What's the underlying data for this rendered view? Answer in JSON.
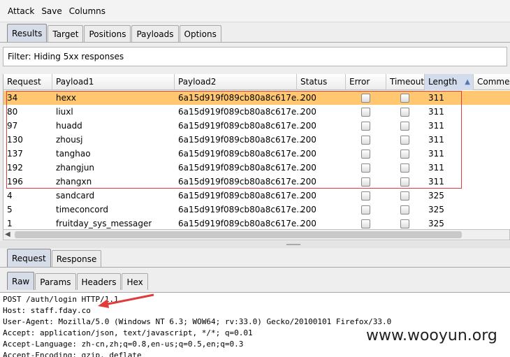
{
  "menu": [
    "Attack",
    "Save",
    "Columns"
  ],
  "main_tabs": [
    {
      "label": "Results",
      "active": true
    },
    {
      "label": "Target",
      "active": false
    },
    {
      "label": "Positions",
      "active": false
    },
    {
      "label": "Payloads",
      "active": false
    },
    {
      "label": "Options",
      "active": false
    }
  ],
  "filter_text": "Filter: Hiding 5xx responses",
  "columns": [
    "Request",
    "Payload1",
    "Payload2",
    "Status",
    "Error",
    "Timeout",
    "Length",
    "Commen"
  ],
  "sort_column": "Length",
  "rows": [
    {
      "request": "34",
      "payload1": "hexx",
      "payload2": "6a15d919f089cb80a8c617e...",
      "status": "200",
      "length": "311",
      "selected": true
    },
    {
      "request": "80",
      "payload1": "liuxl",
      "payload2": "6a15d919f089cb80a8c617e...",
      "status": "200",
      "length": "311"
    },
    {
      "request": "97",
      "payload1": "huadd",
      "payload2": "6a15d919f089cb80a8c617e...",
      "status": "200",
      "length": "311"
    },
    {
      "request": "130",
      "payload1": "zhousj",
      "payload2": "6a15d919f089cb80a8c617e...",
      "status": "200",
      "length": "311"
    },
    {
      "request": "137",
      "payload1": "tanghao",
      "payload2": "6a15d919f089cb80a8c617e...",
      "status": "200",
      "length": "311"
    },
    {
      "request": "192",
      "payload1": "zhangjun",
      "payload2": "6a15d919f089cb80a8c617e...",
      "status": "200",
      "length": "311"
    },
    {
      "request": "196",
      "payload1": "zhangxn",
      "payload2": "6a15d919f089cb80a8c617e...",
      "status": "200",
      "length": "311"
    },
    {
      "request": "4",
      "payload1": "sandcard",
      "payload2": "6a15d919f089cb80a8c617e...",
      "status": "200",
      "length": "325"
    },
    {
      "request": "5",
      "payload1": "timeconcord",
      "payload2": "6a15d919f089cb80a8c617e...",
      "status": "200",
      "length": "325"
    },
    {
      "request": "1",
      "payload1": "fruitday_sys_messager",
      "payload2": "6a15d919f089cb80a8c617e...",
      "status": "200",
      "length": "325"
    }
  ],
  "req_resp_tabs": [
    {
      "label": "Request",
      "active": true
    },
    {
      "label": "Response",
      "active": false
    }
  ],
  "view_tabs": [
    {
      "label": "Raw",
      "active": true
    },
    {
      "label": "Params",
      "active": false
    },
    {
      "label": "Headers",
      "active": false
    },
    {
      "label": "Hex",
      "active": false
    }
  ],
  "raw_lines": [
    "POST /auth/login HTTP/1.1",
    "Host: staff.fday.co",
    "User-Agent: Mozilla/5.0 (Windows NT 6.3; WOW64; rv:33.0) Gecko/20100101 Firefox/33.0",
    "Accept: application/json, text/javascript, */*; q=0.01",
    "Accept-Language: zh-cn,zh;q=0.8,en-us;q=0.5,en;q=0.3",
    "Accept-Encoding: gzip, deflate"
  ],
  "watermark": "www.wooyun.org",
  "colors": {
    "selected_row": "#ffc870",
    "annotation_red": "#e23b3b",
    "active_tab": "#d6dde8"
  }
}
